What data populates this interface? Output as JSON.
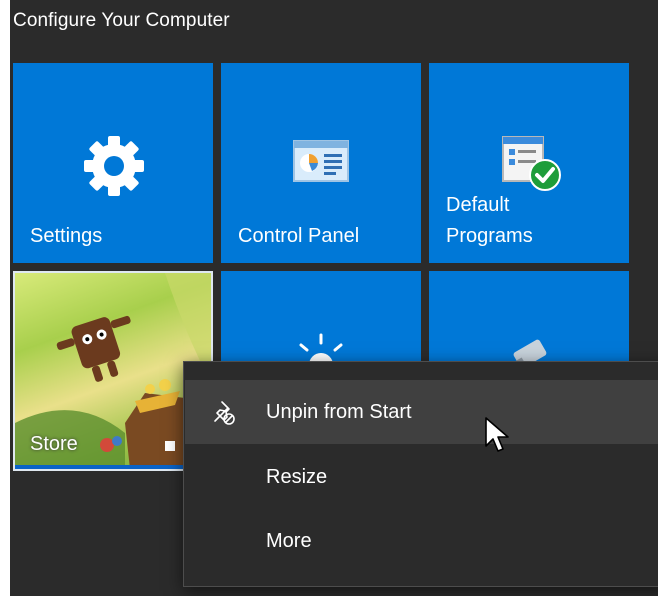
{
  "group": {
    "title": "Configure Your Computer"
  },
  "tiles": [
    {
      "label": "Settings",
      "icon": "gear-icon"
    },
    {
      "label": "Control Panel",
      "icon": "control-panel-icon"
    },
    {
      "label_line1": "Default",
      "label_line2": "Programs",
      "icon": "default-programs-icon"
    },
    {
      "label": "Store",
      "icon": "store-artwork"
    },
    {
      "icon": "sun-icon"
    },
    {
      "icon": "satellite-icon"
    }
  ],
  "context_menu": {
    "items": [
      {
        "label": "Unpin from Start",
        "icon": "unpin-icon"
      },
      {
        "label": "Resize",
        "icon": "chevron-right-icon"
      },
      {
        "label": "More",
        "icon": "chevron-right-icon"
      }
    ]
  },
  "colors": {
    "tile_blue": "#0078d7",
    "start_bg": "#2b2b2b",
    "menu_highlight": "#404040"
  }
}
